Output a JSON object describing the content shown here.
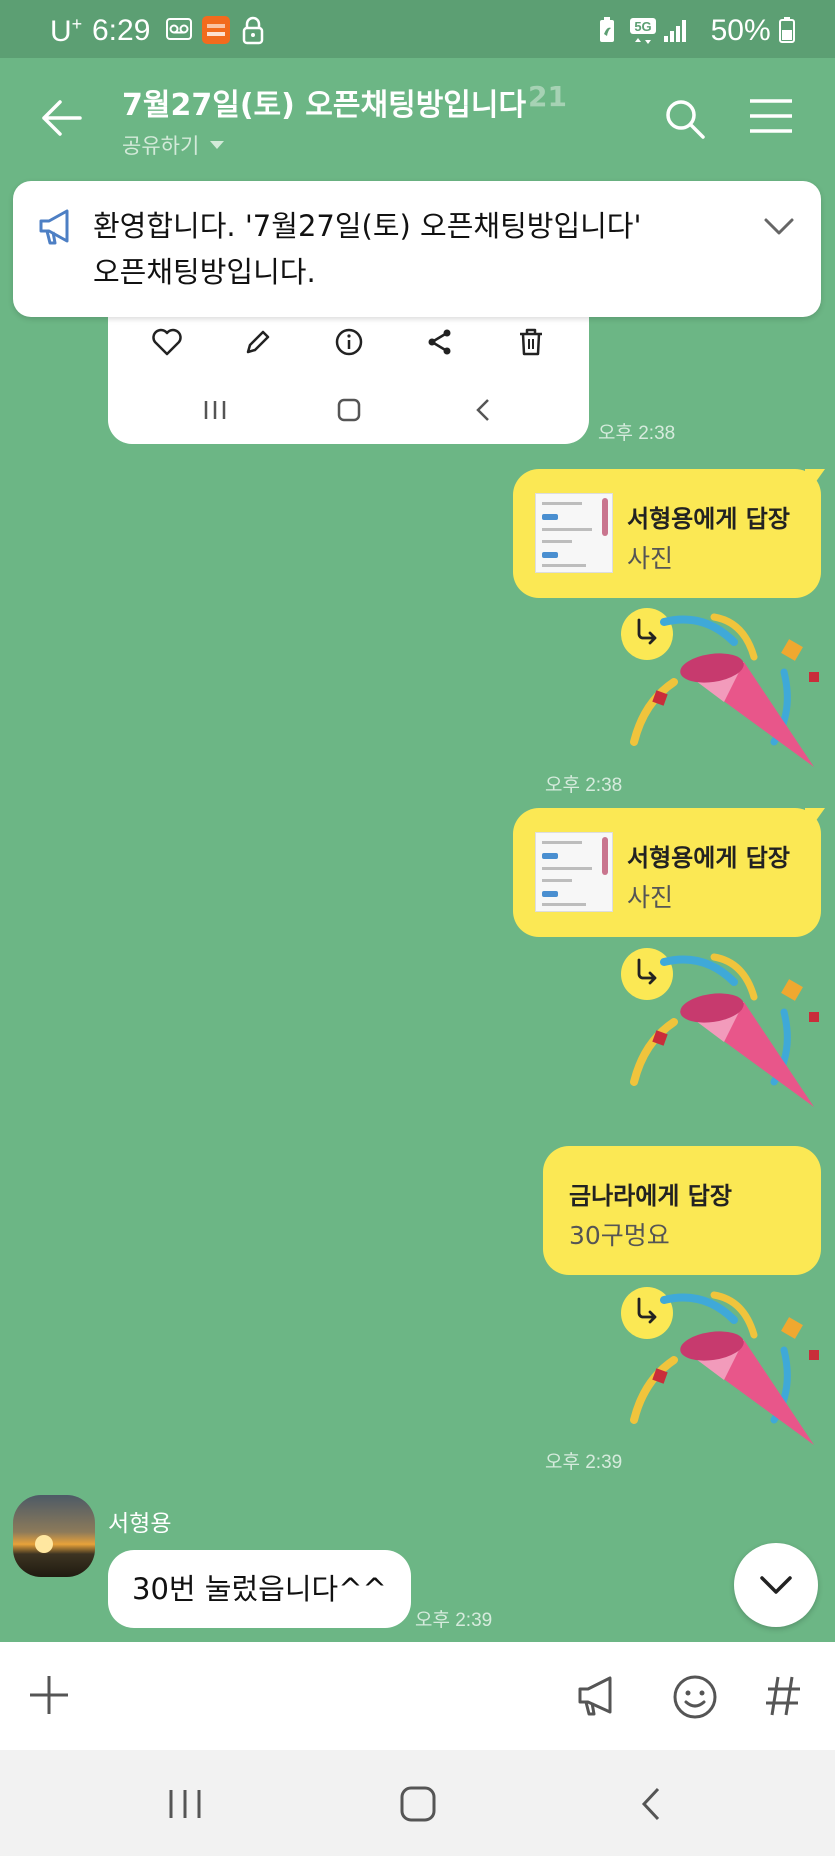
{
  "status_bar": {
    "carrier": "U",
    "carrier_sup": "+",
    "time": "6:29",
    "network": "5G",
    "battery": "50%"
  },
  "header": {
    "title": "7월27일(토) 오픈채팅방입니다",
    "member_count": "21",
    "share_label": "공유하기"
  },
  "notice": {
    "line1": "환영합니다. '7월27일(토) 오픈채팅방입니다'",
    "line2": "오픈채팅방입니다."
  },
  "messages": {
    "prev_time": "오후 2:38",
    "m1": {
      "reply_title": "서형용에게 답장",
      "reply_sub": "사진",
      "time": "오후 2:38"
    },
    "m2": {
      "reply_title": "서형용에게 답장",
      "reply_sub": "사진"
    },
    "m3": {
      "reply_title": "금나라에게 답장",
      "reply_sub": "30구멍요",
      "time": "오후 2:39"
    },
    "incoming": {
      "sender": "서형용",
      "text": "30번 눌렀읍니다^^",
      "time": "오후 2:39"
    }
  },
  "colors": {
    "chat_background": "#6cb685",
    "my_bubble": "#fbe854",
    "their_bubble": "#ffffff"
  }
}
